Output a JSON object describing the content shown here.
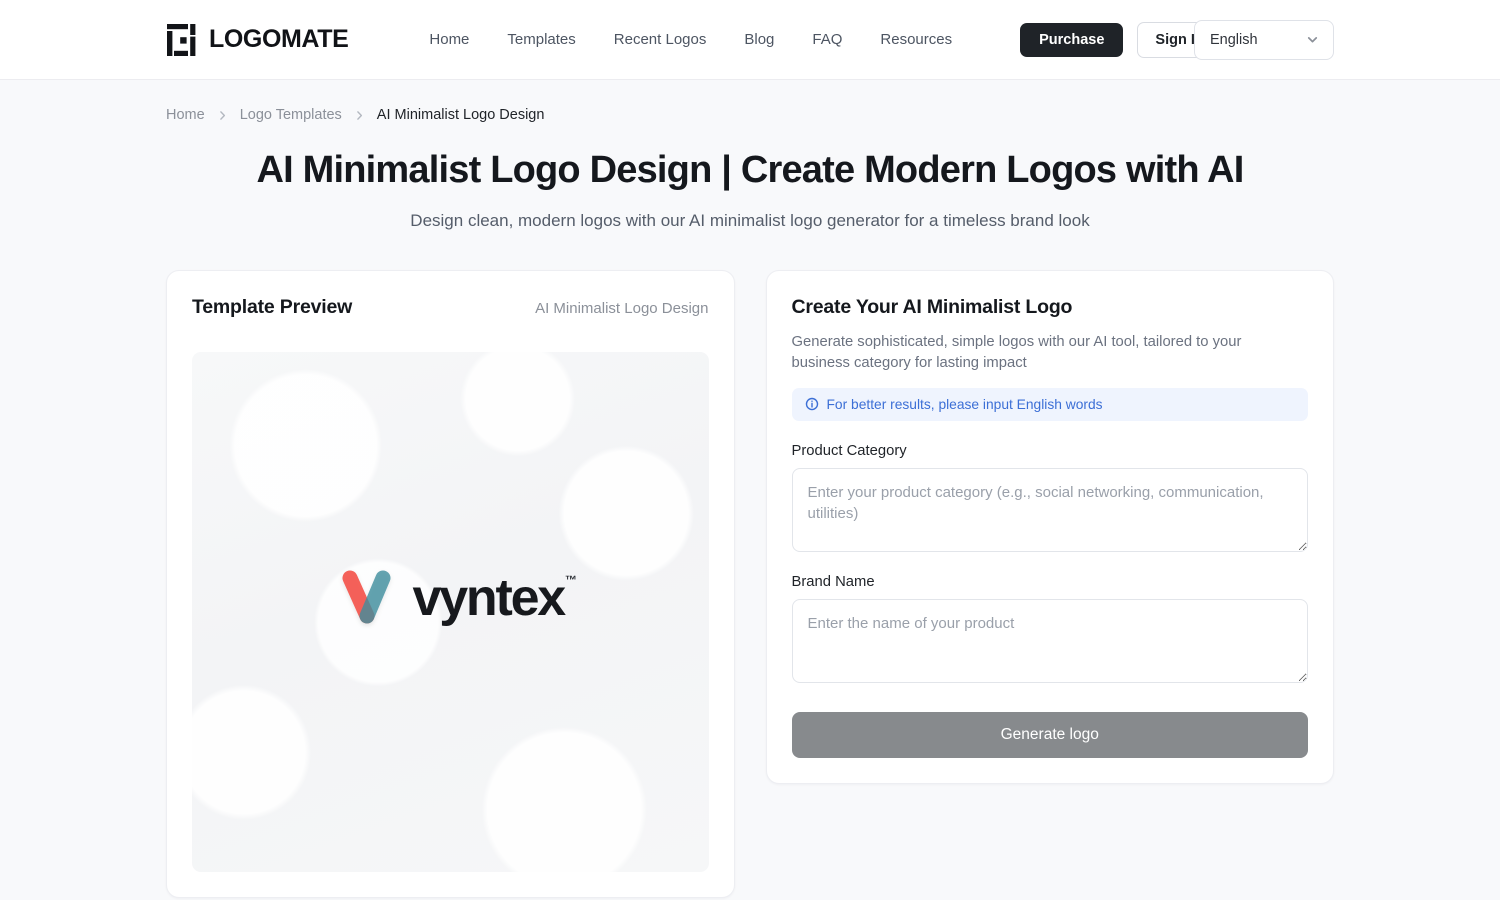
{
  "header": {
    "brand_name": "LOGOMATE",
    "brand_mark_icon": "logomate-square-bracket-icon",
    "nav": [
      {
        "label": "Home"
      },
      {
        "label": "Templates"
      },
      {
        "label": "Recent Logos"
      },
      {
        "label": "Blog"
      },
      {
        "label": "FAQ"
      },
      {
        "label": "Resources"
      }
    ],
    "purchase_label": "Purchase",
    "signin_label": "Sign In",
    "language": {
      "selected": "English",
      "chevron_icon": "chevron-down-icon"
    }
  },
  "breadcrumb": {
    "items": [
      {
        "label": "Home",
        "current": false
      },
      {
        "label": "Logo Templates",
        "current": false
      },
      {
        "label": "AI Minimalist Logo Design",
        "current": true
      }
    ],
    "separator_icon": "chevron-right-icon"
  },
  "hero": {
    "title": "AI Minimalist Logo Design | Create Modern Logos with AI",
    "subtitle": "Design clean, modern logos with our AI minimalist logo generator for a timeless brand look"
  },
  "preview": {
    "title": "Template Preview",
    "tag": "AI Minimalist Logo Design",
    "logo": {
      "wordmark": "vyntex",
      "trademark": "™",
      "mark_icon": "vyntex-v-mark-icon",
      "color_left": "#f4564f",
      "color_right": "#3f8d9e",
      "color_overlap": "#8f4f85"
    }
  },
  "form": {
    "title": "Create Your AI Minimalist Logo",
    "description": "Generate sophisticated, simple logos with our AI tool, tailored to your business category for lasting impact",
    "notice": {
      "icon": "info-circle-icon",
      "text": "For better results, please input English words",
      "bg_color": "#eff4fe",
      "text_color": "#3c6fd6"
    },
    "product_category": {
      "label": "Product Category",
      "placeholder": "Enter your product category (e.g., social networking, communication, utilities)",
      "value": ""
    },
    "brand_name": {
      "label": "Brand Name",
      "placeholder": "Enter the name of your product",
      "value": ""
    },
    "generate_label": "Generate logo",
    "generate_color": "#878a8d"
  }
}
